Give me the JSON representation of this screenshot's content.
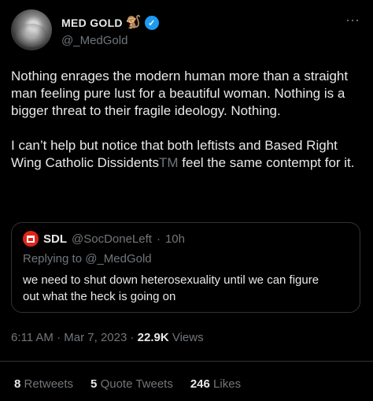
{
  "author": {
    "display_name": "MED GOLD",
    "emoji": "🐒",
    "handle": "@_MedGold",
    "more_icon": "⋯"
  },
  "tweet": {
    "text_part1": "Nothing enrages the modern human more than a straight man feeling pure lust for a beautiful woman. Nothing is a bigger threat to their fragile ideology. Nothing.\n\nI can’t help but notice that both leftists and Based Right Wing Catholic Dissidents",
    "tm": "TM",
    "text_part2": " feel the same contempt for it."
  },
  "quote": {
    "name": "SDL",
    "handle": "@SocDoneLeft",
    "separator": "·",
    "time": "10h",
    "replying_to": "Replying to @_MedGold",
    "text": "we need to shut down heterosexuality until we can figure out what the heck is going on"
  },
  "meta": {
    "time": "6:11 AM",
    "separator": "·",
    "date": "Mar 7, 2023",
    "views_count": "22.9K",
    "views_label": "Views"
  },
  "stats": {
    "retweets_count": "8",
    "retweets_label": "Retweets",
    "quotes_count": "5",
    "quotes_label": "Quote Tweets",
    "likes_count": "246",
    "likes_label": "Likes"
  },
  "colors": {
    "background": "#000000",
    "text": "#e7e9ea",
    "muted": "#71767b",
    "verified": "#1d9bf0",
    "border": "#2f3336"
  }
}
